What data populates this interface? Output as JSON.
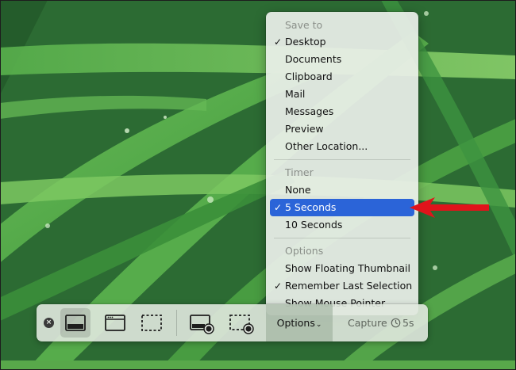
{
  "menu": {
    "save_to_header": "Save to",
    "save_to_items": [
      {
        "label": "Desktop",
        "checked": true
      },
      {
        "label": "Documents",
        "checked": false
      },
      {
        "label": "Clipboard",
        "checked": false
      },
      {
        "label": "Mail",
        "checked": false
      },
      {
        "label": "Messages",
        "checked": false
      },
      {
        "label": "Preview",
        "checked": false
      },
      {
        "label": "Other Location...",
        "checked": false
      }
    ],
    "timer_header": "Timer",
    "timer_items": [
      {
        "label": "None",
        "checked": false
      },
      {
        "label": "5 Seconds",
        "checked": true,
        "selected": true
      },
      {
        "label": "10 Seconds",
        "checked": false
      }
    ],
    "options_header": "Options",
    "options_items": [
      {
        "label": "Show Floating Thumbnail",
        "checked": false
      },
      {
        "label": "Remember Last Selection",
        "checked": true
      },
      {
        "label": "Show Mouse Pointer",
        "checked": false
      }
    ],
    "check_glyph": "✓"
  },
  "toolbar": {
    "close_glyph": "×",
    "options_label": "Options",
    "options_chevron": "⌄",
    "capture_label": "Capture",
    "timer_label": "5s"
  },
  "colors": {
    "selection": "#2b64d8",
    "arrow": "#e0141b"
  },
  "icons": {
    "close": "close-icon",
    "capture_entire_screen": "capture-entire-screen-icon",
    "capture_window": "capture-window-icon",
    "capture_selection": "capture-selection-icon",
    "record_entire_screen": "record-entire-screen-icon",
    "record_selection": "record-selection-icon",
    "timer": "timer-icon",
    "arrow": "red-arrow-icon"
  }
}
